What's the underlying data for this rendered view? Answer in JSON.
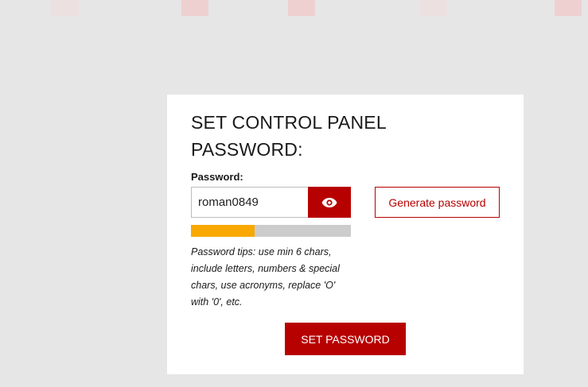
{
  "panel": {
    "title": "SET CONTROL PANEL PASSWORD:",
    "password_label": "Password:",
    "password_value": "roman0849",
    "toggle_icon": "eye-icon",
    "generate_label": "Generate password",
    "strength_fraction": 0.4,
    "strength_color": "#f8a800",
    "tips": "Password tips: use min 6 chars, include letters, numbers & special chars, use acronyms, replace 'O' with '0', etc.",
    "submit_label": "SET PASSWORD"
  },
  "colors": {
    "accent": "#b70000",
    "background": "#e6e6e6",
    "card": "#ffffff",
    "track": "#cccccc"
  }
}
